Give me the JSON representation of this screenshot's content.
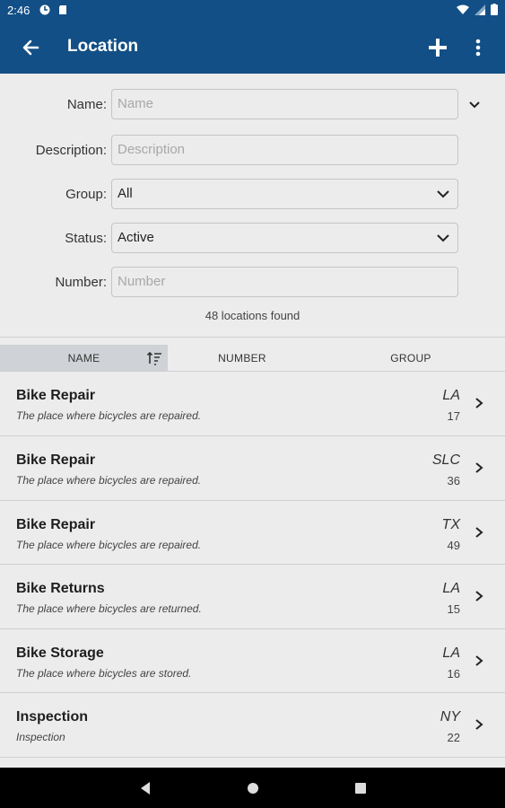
{
  "status_bar": {
    "time": "2:46"
  },
  "app_bar": {
    "title": "Location"
  },
  "form": {
    "name": {
      "label": "Name:",
      "placeholder": "Name"
    },
    "description": {
      "label": "Description:",
      "placeholder": "Description"
    },
    "group": {
      "label": "Group:",
      "value": "All"
    },
    "status": {
      "label": "Status:",
      "value": "Active"
    },
    "number": {
      "label": "Number:",
      "placeholder": "Number"
    },
    "result_count": "48 locations found"
  },
  "columns": [
    {
      "label": "NAME",
      "sorted": true
    },
    {
      "label": "NUMBER"
    },
    {
      "label": "GROUP"
    }
  ],
  "locations": [
    {
      "name": "Bike Repair",
      "description": "The place where bicycles are repaired.",
      "group": "LA",
      "number": "17"
    },
    {
      "name": "Bike Repair",
      "description": "The place where bicycles are repaired.",
      "group": "SLC",
      "number": "36"
    },
    {
      "name": "Bike Repair",
      "description": "The place where bicycles are repaired.",
      "group": "TX",
      "number": "49"
    },
    {
      "name": "Bike Returns",
      "description": "The place where bicycles are returned.",
      "group": "LA",
      "number": "15"
    },
    {
      "name": "Bike Storage",
      "description": "The place where bicycles are stored.",
      "group": "LA",
      "number": "16"
    },
    {
      "name": "Inspection",
      "description": "Inspection",
      "group": "NY",
      "number": "22"
    }
  ],
  "colors": {
    "primary": "#124f86",
    "background": "#ececec",
    "active_tab": "#cfd2d6"
  },
  "icons": {
    "back": "arrow-back-icon",
    "add": "plus-icon",
    "more": "more-vert-icon",
    "sort": "sort-icon",
    "chevron": "chevron-right-icon"
  }
}
